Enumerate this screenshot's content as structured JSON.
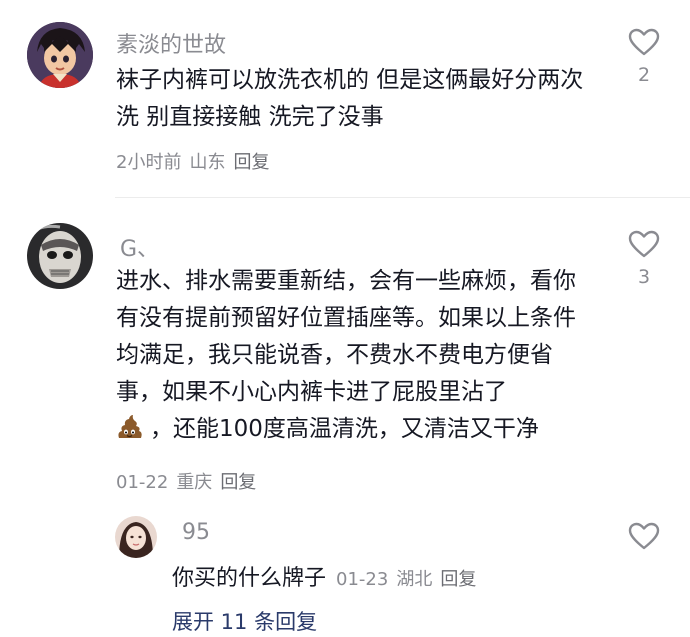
{
  "comments": [
    {
      "username": "素淡的世故",
      "text": "袜子内裤可以放洗衣机的 但是这俩最好分两次洗 别直接接触 洗完了没事",
      "time": "2小时前",
      "location": "山东",
      "reply_label": "回复",
      "likes": "2",
      "avatar_icon": "anime-character-avatar"
    },
    {
      "username": "G、",
      "text_main": "进水、排水需要重新结，会有一些麻烦，看你有没有提前预留好位置插座等。如果以上条件均满足，我只能说香，不费水不费电方便省事，如果不小心内裤卡进了屁股里沾了",
      "emoji": "poop-emoji",
      "text_after_emoji": "，还能100度高温清洗，又清洁又干净",
      "time": "01-22",
      "location": "重庆",
      "reply_label": "回复",
      "likes": "3",
      "avatar_icon": "masked-face-avatar"
    }
  ],
  "reply": {
    "username": "95",
    "text": "你买的什么牌子",
    "time": "01-23",
    "location": "湖北",
    "reply_label": "回复",
    "avatar_icon": "girl-photo-avatar"
  },
  "expand_label": "展开 11 条回复",
  "colors": {
    "text": "#161823",
    "meta": "#8a8b91",
    "link": "#2a3a6a"
  }
}
